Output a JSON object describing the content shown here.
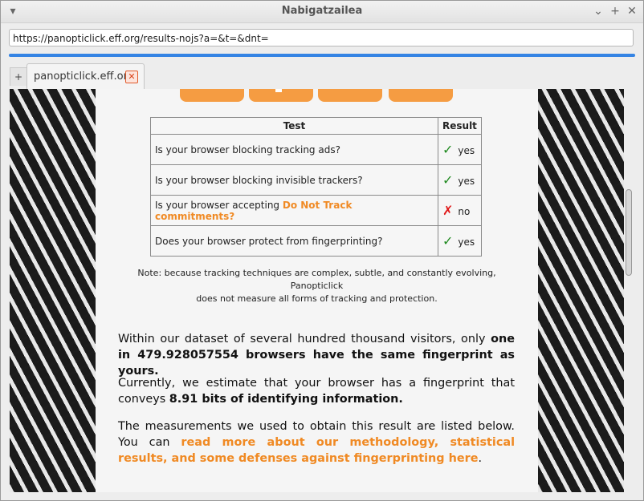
{
  "window": {
    "title": "Nabigatzailea"
  },
  "address_bar": {
    "url": "https://panopticlick.eff.org/results-nojs?a=&t=&dnt="
  },
  "tabs": [
    {
      "label": "panopticlick.eff.org"
    }
  ],
  "new_tab_label": "+",
  "close_tab_label": "✕",
  "table": {
    "headers": [
      "Test",
      "Result"
    ],
    "rows": [
      {
        "question": "Is your browser blocking tracking ads?",
        "mark": "✓",
        "result": "yes"
      },
      {
        "question": "Is your browser blocking invisible trackers?",
        "mark": "✓",
        "result": "yes"
      },
      {
        "question_prefix": "Is your browser accepting ",
        "question_link": "Do Not Track commitments?",
        "mark": "✗",
        "result": "no"
      },
      {
        "question": "Does your browser protect from fingerprinting?",
        "mark": "✓",
        "result": "yes"
      }
    ]
  },
  "note": {
    "line1": "Note: because tracking techniques are complex, subtle, and constantly evolving, Panopticlick",
    "line2": "does not measure all forms of tracking and protection."
  },
  "summary": {
    "p1_prefix": "Within our dataset of several hundred thousand visitors, only ",
    "p1_bold": "one in 479.928057554 browsers have the same fingerprint as yours.",
    "p2_prefix": "Currently, we estimate that your browser has a fingerprint that conveys ",
    "p2_bold": "8.91 bits of identifying information.",
    "p3_prefix": "The measurements we used to obtain this result are listed below. You can ",
    "p3_link": "read more about our methodology, statistical results, and some defenses against fingerprinting here",
    "p3_suffix": "."
  },
  "colors": {
    "accent_orange": "#f08a24",
    "progress_blue": "#3584e4",
    "check_green": "#1f8a1f",
    "cross_red": "#e01818"
  }
}
